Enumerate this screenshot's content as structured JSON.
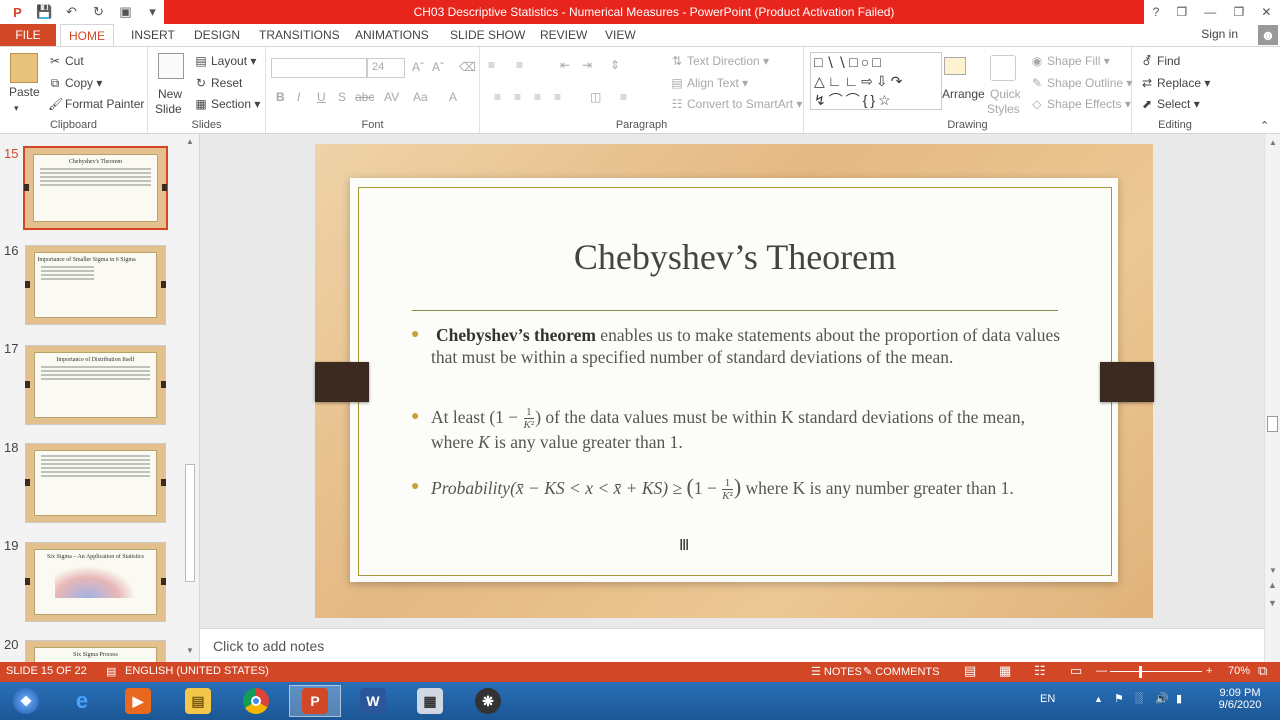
{
  "window": {
    "title": "CH03 Descriptive Statistics - Numerical Measures -  PowerPoint (Product Activation Failed)",
    "controls": [
      "?",
      "❐",
      "—",
      "❐",
      "✕"
    ]
  },
  "ribbon_tabs": [
    "FILE",
    "HOME",
    "INSERT",
    "DESIGN",
    "TRANSITIONS",
    "ANIMATIONS",
    "SLIDE SHOW",
    "REVIEW",
    "VIEW"
  ],
  "account": {
    "signin": "Sign in"
  },
  "ribbon": {
    "clipboard": {
      "paste": "Paste",
      "cut": "Cut",
      "copy": "Copy",
      "format_painter": "Format Painter",
      "label": "Clipboard"
    },
    "slides": {
      "new_slide": "New",
      "new_slide2": "Slide",
      "layout": "Layout",
      "reset": "Reset",
      "section": "Section",
      "label": "Slides"
    },
    "font": {
      "size": "24",
      "label": "Font"
    },
    "paragraph": {
      "text_direction": "Text Direction",
      "align_text": "Align Text",
      "smartart": "Convert to SmartArt",
      "label": "Paragraph"
    },
    "drawing": {
      "arrange": "Arrange",
      "quick_styles": "Quick",
      "quick_styles2": "Styles",
      "shape_fill": "Shape Fill",
      "shape_outline": "Shape Outline",
      "shape_effects": "Shape Effects",
      "label": "Drawing"
    },
    "editing": {
      "find": "Find",
      "replace": "Replace",
      "select": "Select",
      "label": "Editing"
    }
  },
  "thumbnails": [
    {
      "num": "15",
      "title": "Chebyshev's Theorem"
    },
    {
      "num": "16",
      "title": "Importance of Smaller Sigma in 6 Sigma"
    },
    {
      "num": "17",
      "title": "Importance of Distribution Itself"
    },
    {
      "num": "18",
      "title": ""
    },
    {
      "num": "19",
      "title": "Six Sigma – An Application of Statistics"
    },
    {
      "num": "20",
      "title": "Six Sigma Process"
    }
  ],
  "slide": {
    "title": "Chebyshev’s Theorem",
    "bullet1_bold": "Chebyshev’s theorem",
    "bullet1_rest": " enables us to make statements about the proportion of data values that must be within a specified number of standard deviations of the mean.",
    "bullet2_a": "At least",
    "bullet2_b": "of the data values must be within K standard deviations of the mean, where",
    "bullet2_c": "is any value greater than 1.",
    "bullet3_prob": "Probability",
    "bullet3_rest": "where K is any number greater than 1."
  },
  "notes": {
    "placeholder": "Click to add notes"
  },
  "status": {
    "slide": "SLIDE 15 OF 22",
    "language": "ENGLISH (UNITED STATES)",
    "notes": "NOTES",
    "comments": "COMMENTS",
    "zoom": "70%"
  },
  "taskbar": {
    "lang": "EN",
    "time": "9:09 PM",
    "date": "9/6/2020"
  },
  "colors": {
    "accent": "#d24726",
    "title_bar": "#e8251c"
  }
}
